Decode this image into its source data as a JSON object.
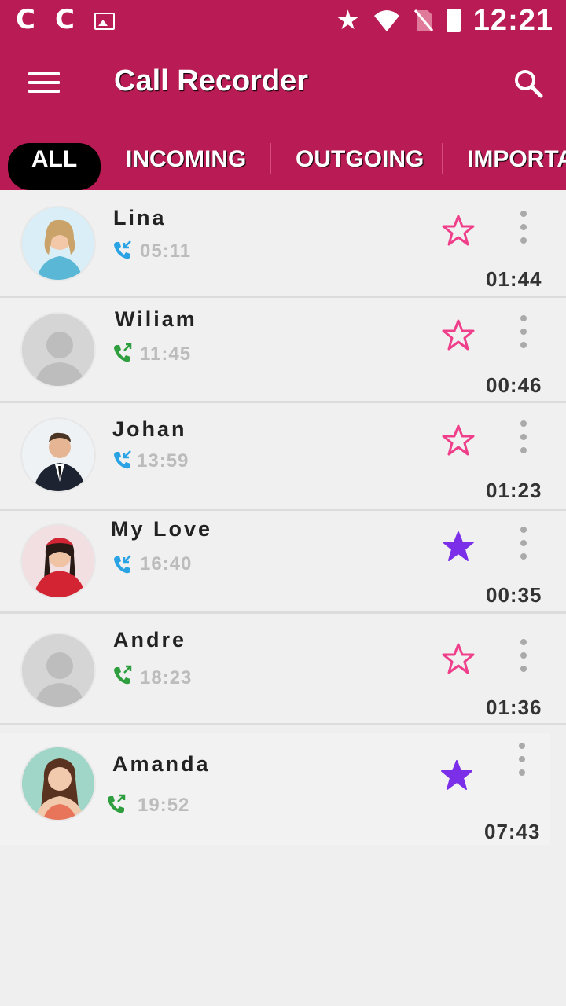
{
  "status_bar": {
    "time": "12:21",
    "left_icons": [
      "C",
      "C"
    ]
  },
  "app_bar": {
    "title": "Call Recorder"
  },
  "tabs": [
    {
      "label": "ALL",
      "active": true
    },
    {
      "label": "INCOMING",
      "active": false
    },
    {
      "label": "OUTGOING",
      "active": false
    },
    {
      "label": "IMPORTANT",
      "active": false
    }
  ],
  "colors": {
    "primary": "#b91c54",
    "incoming": "#29a3e3",
    "outgoing": "#2e9e3e",
    "fav_off": "#ef3f8a",
    "fav_on": "#7b2fe8"
  },
  "recordings": [
    {
      "name": "Lina",
      "time": "05:11",
      "direction": "incoming",
      "important": false,
      "duration": "01:44",
      "avatar": "photo"
    },
    {
      "name": "Wiliam",
      "time": "11:45",
      "direction": "outgoing",
      "important": false,
      "duration": "00:46",
      "avatar": "placeholder"
    },
    {
      "name": "Johan",
      "time": "13:59",
      "direction": "incoming",
      "important": false,
      "duration": "01:23",
      "avatar": "photo"
    },
    {
      "name": "My Love",
      "time": "16:40",
      "direction": "incoming",
      "important": true,
      "duration": "00:35",
      "avatar": "photo"
    },
    {
      "name": "Andre",
      "time": "18:23",
      "direction": "outgoing",
      "important": false,
      "duration": "01:36",
      "avatar": "placeholder"
    },
    {
      "name": "Amanda",
      "time": "19:52",
      "direction": "outgoing",
      "important": true,
      "duration": "07:43",
      "avatar": "photo"
    }
  ]
}
